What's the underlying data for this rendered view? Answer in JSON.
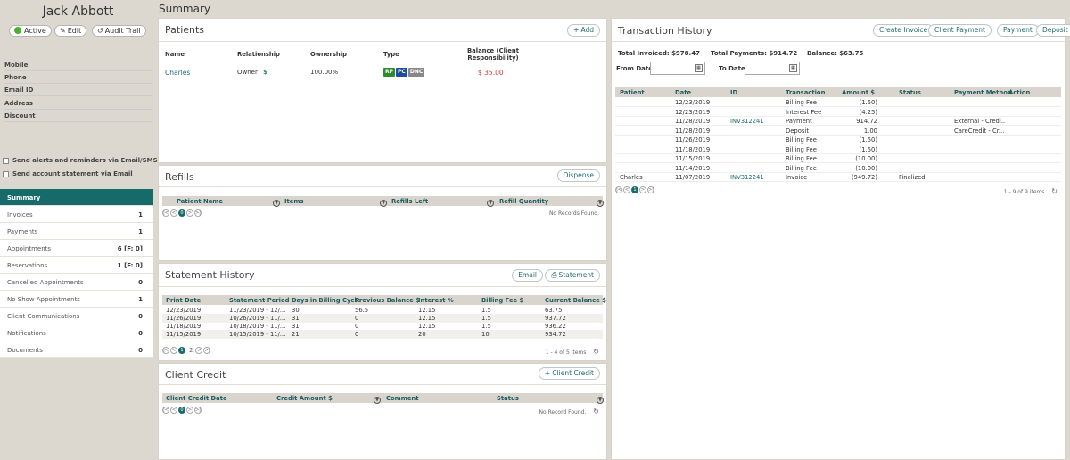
{
  "client": {
    "name": "Jack Abbott",
    "status": "Active",
    "edit": "Edit",
    "audit": "Audit Trail",
    "fields": [
      "Mobile",
      "Phone",
      "Email ID",
      "Address",
      "Discount"
    ],
    "opt_alerts": "Send alerts and reminders via Email/SMS",
    "opt_statement": "Send account statement via Email"
  },
  "nav": [
    {
      "label": "Summary",
      "count": ""
    },
    {
      "label": "Invoices",
      "count": "1"
    },
    {
      "label": "Payments",
      "count": "1"
    },
    {
      "label": "Appointments",
      "count": "6  [F: 0]"
    },
    {
      "label": "Reservations",
      "count": "1  [F: 0]"
    },
    {
      "label": "Cancelled Appointments",
      "count": "0"
    },
    {
      "label": "No Show Appointments",
      "count": "1"
    },
    {
      "label": "Client Communications",
      "count": "0"
    },
    {
      "label": "Notifications",
      "count": "0"
    },
    {
      "label": "Documents",
      "count": "0"
    }
  ],
  "page_title": "Summary",
  "patients": {
    "title": "Patients",
    "add": "Add",
    "headers": {
      "name": "Name",
      "rel": "Relationship",
      "own": "Ownership",
      "type": "Type",
      "bal1": "Balance (Client",
      "bal2": "Responsibility)"
    },
    "row": {
      "name": "Charles",
      "rel": "Owner",
      "dollar": "$",
      "own": "100.00%",
      "tags": [
        "RP",
        "PC",
        "DNC"
      ],
      "bal": "$ 35.00"
    }
  },
  "refills": {
    "title": "Refills",
    "dispense": "Dispense",
    "headers": [
      "Patient Name",
      "Items",
      "Refills Left",
      "Refill Quantity"
    ],
    "page": "0",
    "empty": "No Records Found."
  },
  "statement": {
    "title": "Statement History",
    "email": "Email",
    "statement_btn": "Statement",
    "headers": [
      "Print Date",
      "Statement Period",
      "Days in Billing Cycle",
      "Previous Balance $",
      "Interest %",
      "Billing Fee $",
      "Current Balance $"
    ],
    "rows": [
      [
        "12/23/2019",
        "11/23/2019 - 12/...",
        "30",
        "56.5",
        "12.15",
        "1.5",
        "63.75"
      ],
      [
        "11/26/2019",
        "10/26/2019 - 11/...",
        "31",
        "0",
        "12.15",
        "1.5",
        "937.72"
      ],
      [
        "11/18/2019",
        "10/18/2019 - 11/...",
        "31",
        "0",
        "12.15",
        "1.5",
        "936.22"
      ],
      [
        "11/15/2019",
        "10/15/2019 - 11/...",
        "21",
        "0",
        "20",
        "10",
        "934.72"
      ]
    ],
    "pages": [
      "1",
      "2"
    ],
    "info": "1 - 4 of 5 items"
  },
  "credit": {
    "title": "Client Credit",
    "add": "Client Credit",
    "headers": [
      "Client Credit Date",
      "Credit Amount $",
      "Comment",
      "Status"
    ],
    "page": "0",
    "empty": "No Record Found."
  },
  "transactions": {
    "title": "Transaction History",
    "buttons": [
      "Create Invoice",
      "Client Payment",
      "Payment",
      "Deposit"
    ],
    "total_invoiced": "Total Invoiced: $978.47",
    "total_payments": "Total Payments: $914.72",
    "balance": "Balance: $63.75",
    "from": "From Date",
    "to": "To Date",
    "headers": [
      "Patient",
      "Date",
      "ID",
      "Transaction",
      "Amount $",
      "Status",
      "Payment Method",
      "Action"
    ],
    "rows": [
      [
        "",
        "12/23/2019",
        "",
        "Billing Fee",
        "(1.50)",
        "",
        "",
        ""
      ],
      [
        "",
        "12/23/2019",
        "",
        "Interest Fee",
        "(4.25)",
        "",
        "",
        ""
      ],
      [
        "",
        "11/28/2019",
        "INV312241",
        "Payment",
        "914.72",
        "",
        "External - Credi...",
        "r"
      ],
      [
        "",
        "11/28/2019",
        "",
        "Deposit",
        "1.00",
        "",
        "CareCredit - Cr...",
        "r"
      ],
      [
        "",
        "11/26/2019",
        "",
        "Billing Fee",
        "(1.50)",
        "",
        "",
        ""
      ],
      [
        "",
        "11/18/2019",
        "",
        "Billing Fee",
        "(1.50)",
        "",
        "",
        ""
      ],
      [
        "",
        "11/15/2019",
        "",
        "Billing Fee",
        "(10.00)",
        "",
        "",
        ""
      ],
      [
        "",
        "11/14/2019",
        "",
        "Billing Fee",
        "(10.00)",
        "",
        "",
        ""
      ],
      [
        "Charles",
        "11/07/2019",
        "INV312241",
        "Invoice",
        "(949.72)",
        "Finalized",
        "",
        "pe"
      ]
    ],
    "page": "1",
    "info": "1 - 9 of 9 items"
  }
}
